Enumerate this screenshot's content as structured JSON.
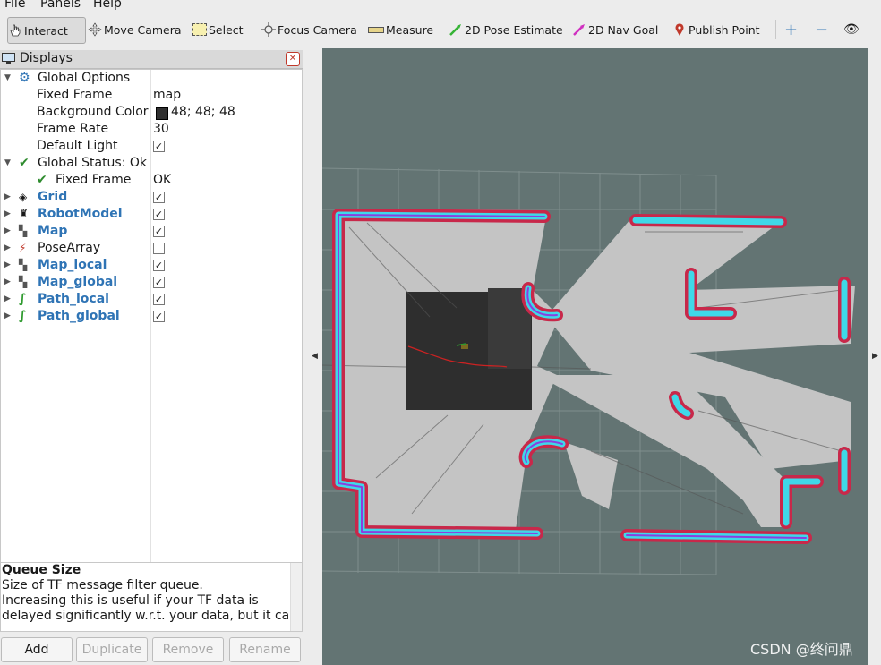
{
  "menu": {
    "file": "File",
    "panels": "Panels",
    "help": "Help"
  },
  "toolbar": {
    "interact": "Interact",
    "move_camera": "Move Camera",
    "select": "Select",
    "focus_camera": "Focus Camera",
    "measure": "Measure",
    "pose_estimate": "2D Pose Estimate",
    "nav_goal": "2D Nav Goal",
    "publish_point": "Publish Point"
  },
  "displays": {
    "title": "Displays",
    "global_options": "Global Options",
    "fixed_frame_label": "Fixed Frame",
    "fixed_frame_value": "map",
    "bg_color_label": "Background Color",
    "bg_color_value": "48; 48; 48",
    "frame_rate_label": "Frame Rate",
    "frame_rate_value": "30",
    "default_light_label": "Default Light",
    "global_status": "Global Status: Ok",
    "status_fixed_frame": "Fixed Frame",
    "status_ok": "OK",
    "items": [
      {
        "label": "Grid",
        "checked": true
      },
      {
        "label": "RobotModel",
        "checked": true
      },
      {
        "label": "Map",
        "checked": true
      },
      {
        "label": "PoseArray",
        "checked": false
      },
      {
        "label": "Map_local",
        "checked": true
      },
      {
        "label": "Map_global",
        "checked": true
      },
      {
        "label": "Path_local",
        "checked": true
      },
      {
        "label": "Path_global",
        "checked": true
      }
    ]
  },
  "description": {
    "title": "Queue Size",
    "line1": "Size of TF message filter queue.",
    "line2": "Increasing this is useful if your TF data is",
    "line3": "delayed significantly w.r.t. your data, but it can"
  },
  "buttons": {
    "add": "Add",
    "duplicate": "Duplicate",
    "remove": "Remove",
    "rename": "Rename"
  },
  "watermark": "CSDN @终问鼎",
  "colors": {
    "bg_swatch": "#303030",
    "viewport": "#637473",
    "costmap_cyan": "#3fd8e8",
    "costmap_red": "#c8284a",
    "path": "#cc2222"
  }
}
